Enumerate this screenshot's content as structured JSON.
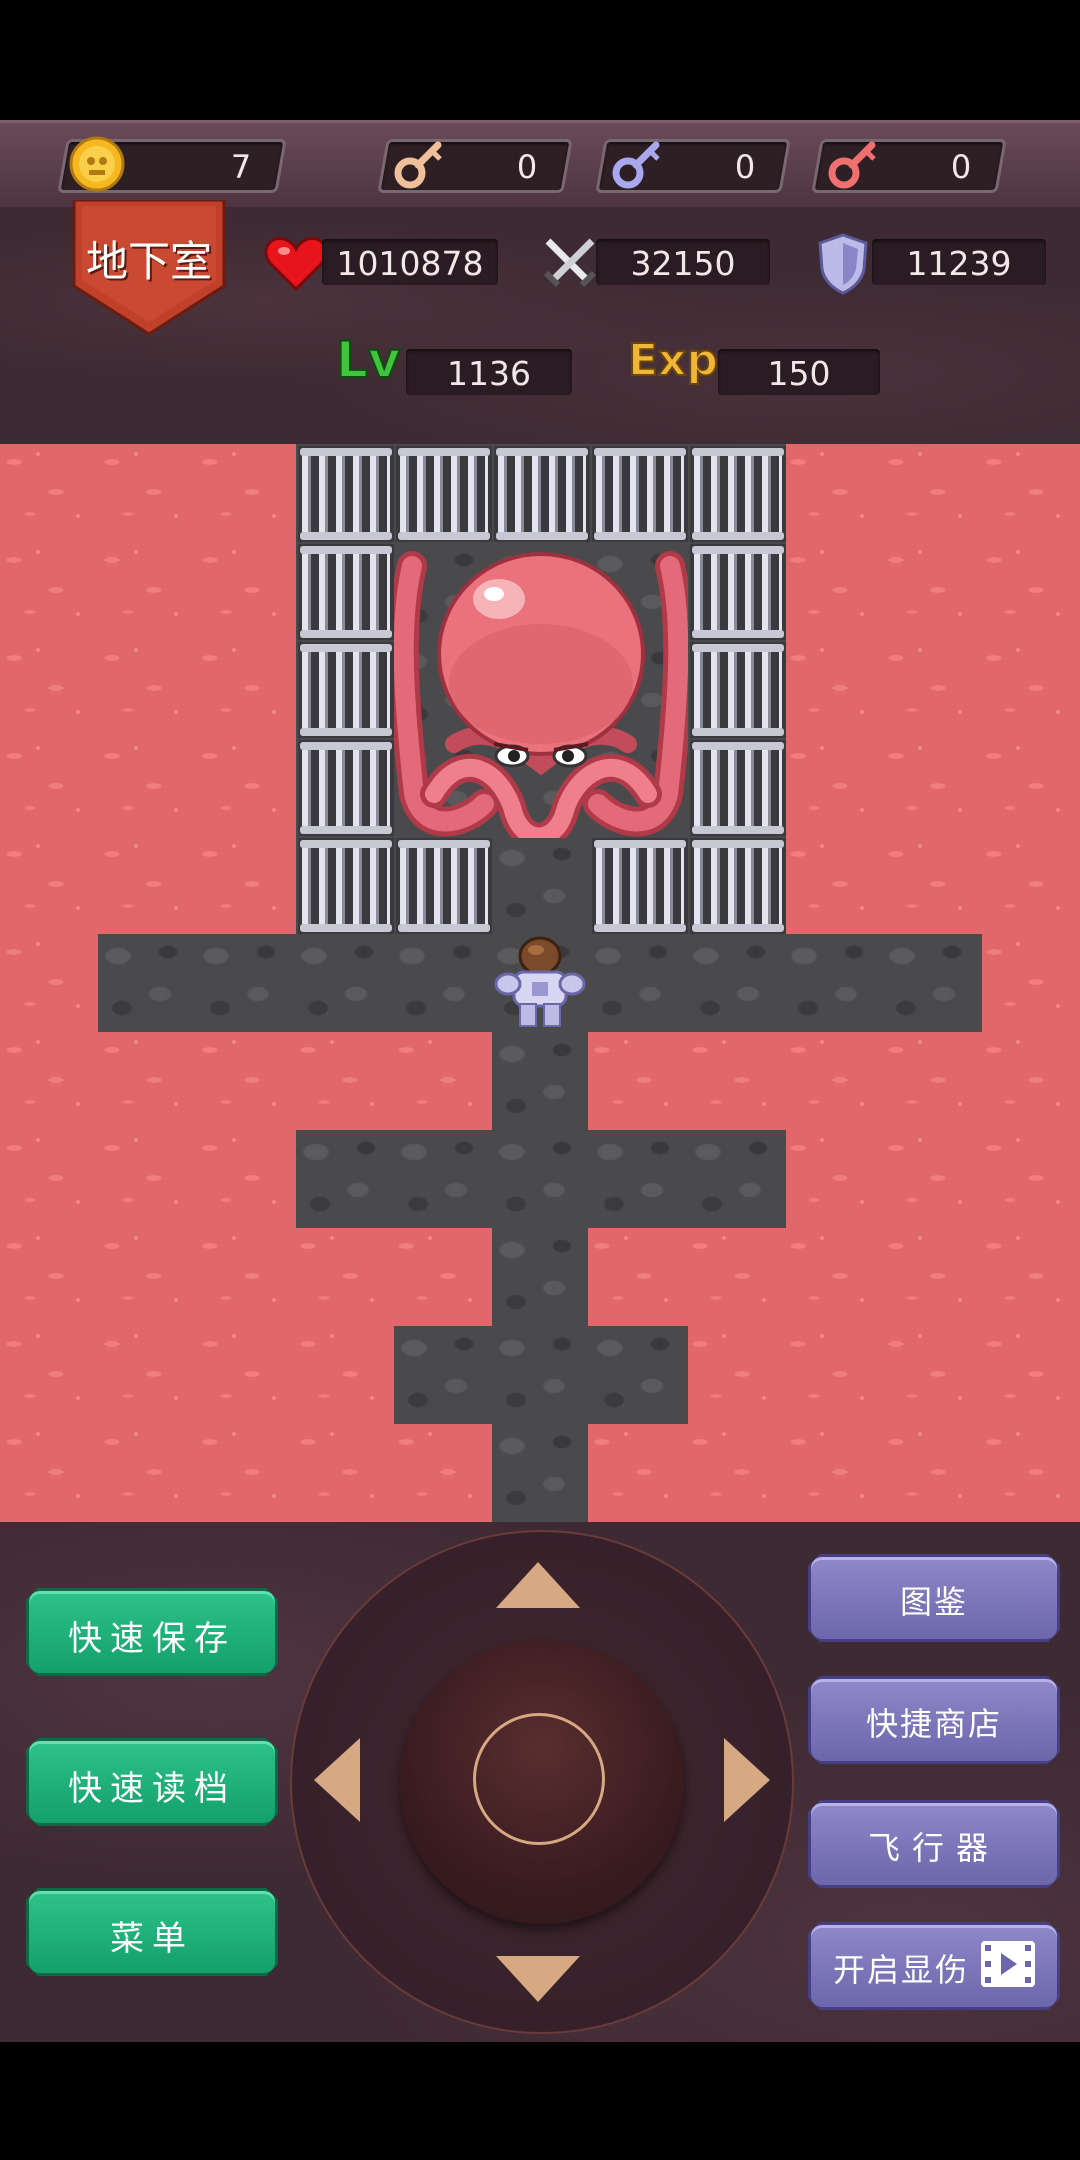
{
  "resources": {
    "gold": "7",
    "yellow_key": "0",
    "blue_key": "0",
    "red_key": "0"
  },
  "floor": {
    "label": "地下室"
  },
  "stats": {
    "hp": "1010878",
    "attack": "32150",
    "defense": "11239",
    "level_label": "Lv",
    "level": "1136",
    "exp_label": "Exp",
    "exp": "150"
  },
  "controls": {
    "quick_save": "快速保存",
    "quick_load": "快速读档",
    "menu": "菜单",
    "bestiary": "图鉴",
    "quick_shop": "快捷商店",
    "flyer": "飞行器",
    "damage_display": "开启显伤"
  },
  "icons": {
    "gold": "gold-coin-icon",
    "yellow_key": "yellow-key-icon",
    "blue_key": "blue-key-icon",
    "red_key": "red-key-icon",
    "hp": "heart-icon",
    "attack": "crossed-swords-icon",
    "defense": "shield-icon",
    "damage_display": "video-ad-icon"
  },
  "colors": {
    "lava": "#e2676a",
    "floor": "#4a4a4c",
    "green_button": "#1cad77",
    "purple_button": "#7d77ba",
    "banner": "#c0402a",
    "level_label": "#39c23a",
    "exp_label": "#f2b636"
  }
}
